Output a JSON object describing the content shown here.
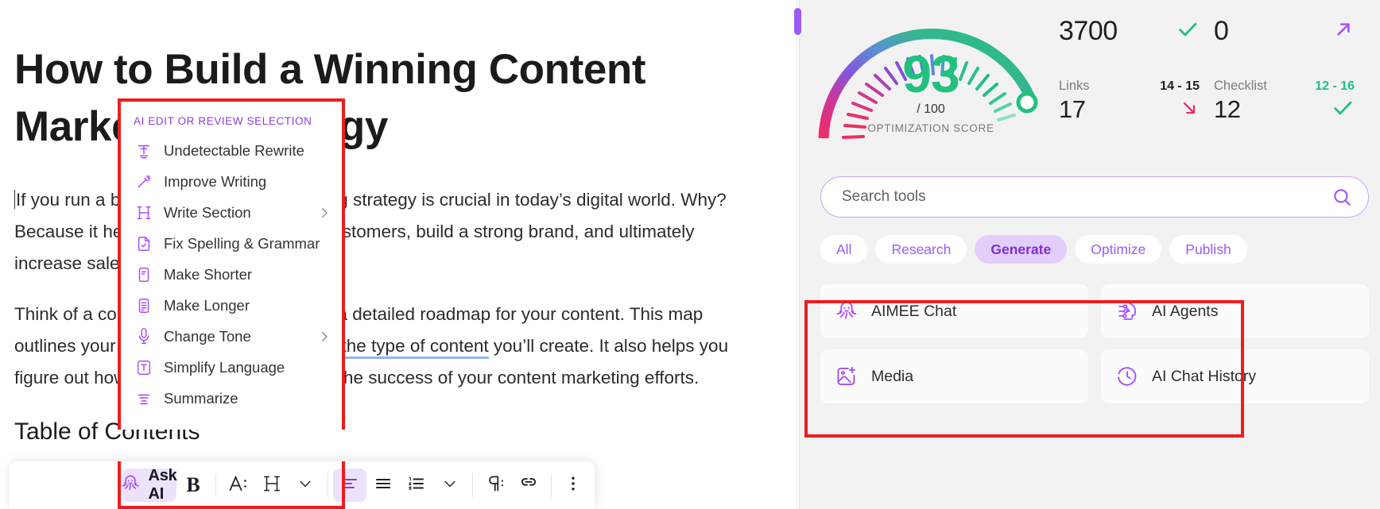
{
  "document": {
    "title": "How to Build a Winning Content Marketing Strategy",
    "paragraph_1": "If you run a business, a content marketing strategy is crucial in today’s digital world. Why? Because it helps you attract and retain customers, build a strong brand, and ultimately increase sales.",
    "paragraph_2_a": "Think of a content marketing strategy as a detailed roadmap for your content. This map outlines your goals, target audience, and ",
    "paragraph_2_link": "the type of content",
    "paragraph_2_b": " you’ll create. It also helps you figure out how to distribute and measure the success of your content marketing efforts.",
    "heading_2": "Table of Contents"
  },
  "ai_menu": {
    "header": "AI EDIT OR REVIEW SELECTION",
    "items": [
      {
        "label": "Undetectable Rewrite",
        "icon": "undetectable-rewrite-icon",
        "submenu": false
      },
      {
        "label": "Improve Writing",
        "icon": "magic-wand-icon",
        "submenu": false
      },
      {
        "label": "Write Section",
        "icon": "heading-h-icon",
        "submenu": true
      },
      {
        "label": "Fix Spelling & Grammar",
        "icon": "document-check-icon",
        "submenu": false
      },
      {
        "label": "Make Shorter",
        "icon": "make-shorter-icon",
        "submenu": false
      },
      {
        "label": "Make Longer",
        "icon": "make-longer-icon",
        "submenu": false
      },
      {
        "label": "Change Tone",
        "icon": "microphone-icon",
        "submenu": true
      },
      {
        "label": "Simplify Language",
        "icon": "text-t-icon",
        "submenu": false
      },
      {
        "label": "Summarize",
        "icon": "summarize-lines-icon",
        "submenu": false
      }
    ],
    "accent_color": "#a64dff",
    "header_color": "#8b3de0",
    "highlight_border_color": "#ef1c1c"
  },
  "format_toolbar": {
    "ask_ai_label": "Ask AI",
    "buttons": [
      {
        "name": "ask-ai-button",
        "label": "Ask AI",
        "icon": "octopus-icon"
      },
      {
        "name": "bold-button",
        "label": "B",
        "icon": "bold-icon"
      },
      {
        "name": "font-size-button",
        "label": "A:",
        "icon": "font-size-icon"
      },
      {
        "name": "heading-button",
        "label": "H",
        "icon": "heading-icon"
      },
      {
        "name": "heading-dropdown",
        "label": "",
        "icon": "chevron-down-icon"
      },
      {
        "name": "align-left-button",
        "label": "",
        "icon": "align-left-icon"
      },
      {
        "name": "bullet-list-button",
        "label": "",
        "icon": "bullet-list-icon"
      },
      {
        "name": "numbered-list-button",
        "label": "",
        "icon": "numbered-list-icon"
      },
      {
        "name": "list-dropdown",
        "label": "",
        "icon": "chevron-down-icon"
      },
      {
        "name": "paragraph-button",
        "label": "",
        "icon": "pilcrow-icon"
      },
      {
        "name": "link-button",
        "label": "",
        "icon": "link-icon"
      },
      {
        "name": "more-options-button",
        "label": "",
        "icon": "kebab-menu-icon"
      }
    ]
  },
  "score_panel": {
    "gauge": {
      "score": "93",
      "out_of": "/ 100",
      "caption": "OPTIMIZATION SCORE",
      "score_color": "#22c07e"
    },
    "stats_top": [
      {
        "name": "word-count",
        "value": "3700",
        "status_icon": "check-icon",
        "status_color": "#22c07e"
      },
      {
        "name": "issues-count",
        "value": "0",
        "status_icon": "arrow-up-right-icon",
        "status_color": "#a64dff"
      }
    ],
    "stats_bottom": [
      {
        "label": "Links",
        "range": "14 - 15",
        "range_color": "#1e1e24",
        "value": "17",
        "status_icon": "arrow-down-right-icon",
        "status_color": "#ef2d63"
      },
      {
        "label": "Checklist",
        "range": "12 - 16",
        "range_color": "#22c07e",
        "value": "12",
        "status_icon": "check-icon",
        "status_color": "#22c07e"
      }
    ]
  },
  "tools": {
    "search": {
      "placeholder": "Search tools",
      "value": "",
      "icon": "search-icon"
    },
    "chips": [
      {
        "label": "All",
        "selected": false
      },
      {
        "label": "Research",
        "selected": false
      },
      {
        "label": "Generate",
        "selected": true
      },
      {
        "label": "Optimize",
        "selected": false
      },
      {
        "label": "Publish",
        "selected": false
      }
    ],
    "cards": [
      {
        "label": "AIMEE Chat",
        "icon": "octopus-icon"
      },
      {
        "label": "AI Agents",
        "icon": "ai-agents-chip-icon"
      },
      {
        "label": "Media",
        "icon": "image-plus-icon"
      },
      {
        "label": "AI Chat History",
        "icon": "clock-history-icon"
      }
    ],
    "highlight_border_color": "#ef1c1c"
  }
}
